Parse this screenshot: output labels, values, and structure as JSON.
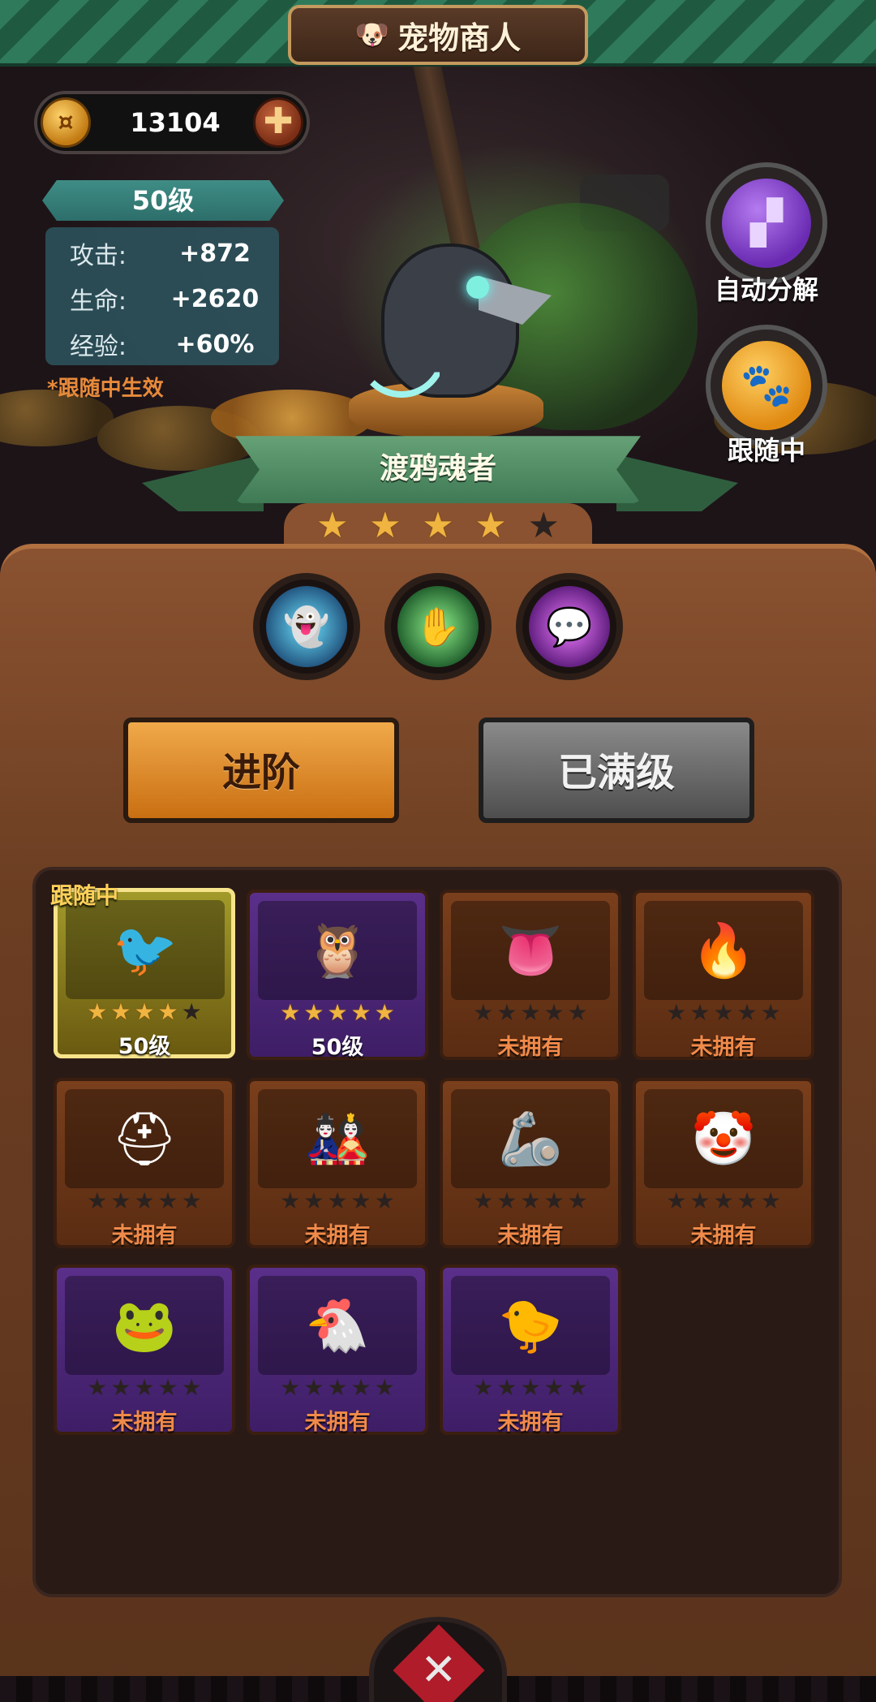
{
  "header": {
    "title": "宠物商人",
    "icon": "dog-head-icon"
  },
  "currency": {
    "amount": "13104",
    "coin_icon": "gold-coin-icon",
    "add_icon": "plus-icon"
  },
  "pet_stats": {
    "level": "50级",
    "rows": [
      {
        "label": "攻击:",
        "value": "+872"
      },
      {
        "label": "生命:",
        "value": "+2620"
      },
      {
        "label": "经验:",
        "value": "+60%"
      }
    ],
    "note": "*跟随中生效"
  },
  "side_buttons": {
    "decompose_label": "自动分解",
    "follow_label": "跟随中"
  },
  "current_pet": {
    "name": "渡鸦魂者",
    "stars_filled": 4,
    "stars_total": 5
  },
  "skills": [
    "ghost-skill-icon",
    "claw-skill-icon",
    "chat-bubble-skill-icon"
  ],
  "buttons": {
    "advance": "进阶",
    "maxed": "已满级"
  },
  "grid": {
    "follow_tag": "跟随中",
    "cards": [
      {
        "name": "raven",
        "level": "50级",
        "stars": 4,
        "color": "selected"
      },
      {
        "name": "owl-spirit",
        "level": "50级",
        "stars": 5,
        "color": "purple"
      },
      {
        "name": "mimic-chest",
        "level": "未拥有",
        "stars": 0,
        "color": "orange"
      },
      {
        "name": "fire-beast",
        "level": "未拥有",
        "stars": 0,
        "color": "orange"
      },
      {
        "name": "knight",
        "level": "未拥有",
        "stars": 0,
        "color": "orange"
      },
      {
        "name": "daruma",
        "level": "未拥有",
        "stars": 0,
        "color": "orange"
      },
      {
        "name": "iron-gauntlet",
        "level": "未拥有",
        "stars": 0,
        "color": "orange"
      },
      {
        "name": "clown",
        "level": "未拥有",
        "stars": 0,
        "color": "orange"
      },
      {
        "name": "green-frog",
        "level": "未拥有",
        "stars": 0,
        "color": "purple"
      },
      {
        "name": "chicken",
        "level": "未拥有",
        "stars": 0,
        "color": "purple"
      },
      {
        "name": "zombie-bird",
        "level": "未拥有",
        "stars": 0,
        "color": "purple"
      }
    ]
  },
  "bottom_nav": {
    "icon": "crossed-swords-icon"
  }
}
